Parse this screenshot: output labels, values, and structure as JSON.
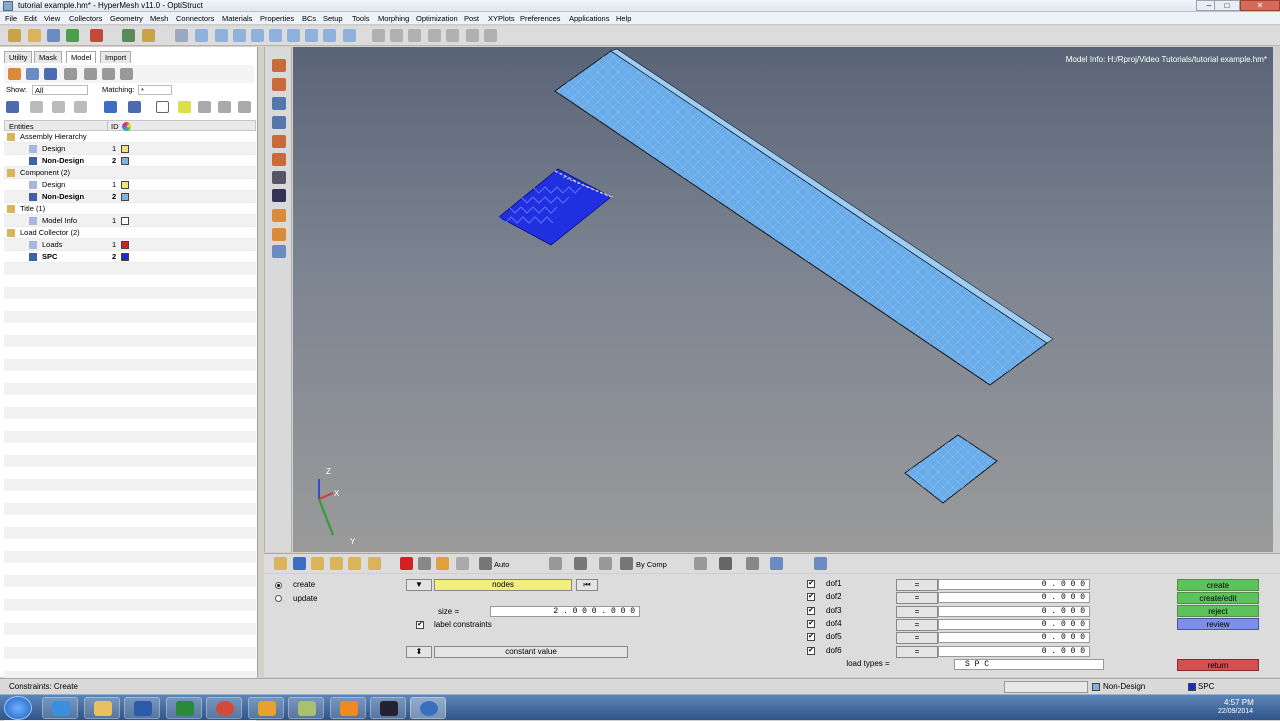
{
  "window": {
    "title": "tutorial example.hm* - HyperMesh v11.0 - OptiStruct",
    "minimize": "–",
    "maximize": "□",
    "close": "✕"
  },
  "menu": [
    "File",
    "Edit",
    "View",
    "Collectors",
    "Geometry",
    "Mesh",
    "Connectors",
    "Materials",
    "Properties",
    "BCs",
    "Setup",
    "Tools",
    "Morphing",
    "Optimization",
    "Post",
    "XYPlots",
    "Preferences",
    "Applications",
    "Help"
  ],
  "left_panel": {
    "tabs": [
      "Utility",
      "Mask",
      "Model",
      "Import"
    ],
    "active_tab": "Model",
    "show_label": "Show:",
    "show_value": "All",
    "matching_label": "Matching:",
    "matching_value": "*",
    "headers": {
      "entities": "Entities",
      "id": "ID"
    },
    "tree": [
      {
        "label": "Assembly Hierarchy",
        "indent": 0,
        "bold": false,
        "id": "",
        "swatch": ""
      },
      {
        "label": "Design",
        "indent": 2,
        "bold": false,
        "id": "1",
        "swatch": "#f2e27a"
      },
      {
        "label": "Non-Design",
        "indent": 2,
        "bold": true,
        "id": "2",
        "swatch": "#7fb2e0"
      },
      {
        "label": "Component (2)",
        "indent": 0,
        "bold": false,
        "id": "",
        "swatch": ""
      },
      {
        "label": "Design",
        "indent": 2,
        "bold": false,
        "id": "1",
        "swatch": "#f2e27a"
      },
      {
        "label": "Non-Design",
        "indent": 2,
        "bold": true,
        "id": "2",
        "swatch": "#7fb2e0"
      },
      {
        "label": "Title (1)",
        "indent": 0,
        "bold": false,
        "id": "",
        "swatch": ""
      },
      {
        "label": "Model Info",
        "indent": 2,
        "bold": false,
        "id": "1",
        "swatch": "#ffffff"
      },
      {
        "label": "Load Collector (2)",
        "indent": 0,
        "bold": false,
        "id": "",
        "swatch": ""
      },
      {
        "label": "Loads",
        "indent": 2,
        "bold": false,
        "id": "1",
        "swatch": "#d42020"
      },
      {
        "label": "SPC",
        "indent": 2,
        "bold": true,
        "id": "2",
        "swatch": "#1d2cc8"
      }
    ]
  },
  "viewport": {
    "model_info": "Model Info: H:/Rproj/Video Tutorials/tutorial example.hm*",
    "axes": {
      "x": "X",
      "y": "Y",
      "z": "Z"
    },
    "colors": {
      "part": "#6aacea",
      "spc": "#2030e0"
    }
  },
  "bottom_toolbar": {
    "vis_mode": "Auto",
    "color_mode": "By Comp"
  },
  "panel": {
    "radio_create": "create",
    "radio_update": "update",
    "selected_radio": "create",
    "entity_selector": "nodes",
    "size_label": "size =",
    "size_value": "2 . 0 0 0 . 0 0 0",
    "label_constraints": "label constraints",
    "label_constraints_checked": true,
    "constant_value": "constant value",
    "dofs": [
      {
        "name": "dof1",
        "checked": true,
        "eq": "=",
        "value": "0 . 0 0 0"
      },
      {
        "name": "dof2",
        "checked": true,
        "eq": "=",
        "value": "0 . 0 0 0"
      },
      {
        "name": "dof3",
        "checked": true,
        "eq": "=",
        "value": "0 . 0 0 0"
      },
      {
        "name": "dof4",
        "checked": true,
        "eq": "=",
        "value": "0 . 0 0 0"
      },
      {
        "name": "dof5",
        "checked": true,
        "eq": "=",
        "value": "0 . 0 0 0"
      },
      {
        "name": "dof6",
        "checked": true,
        "eq": "=",
        "value": "0 . 0 0 0"
      }
    ],
    "load_types_label": "load types =",
    "load_types_value": "S P C",
    "buttons": {
      "create": "create",
      "create_edit": "create/edit",
      "reject": "reject",
      "review": "review",
      "return": "return"
    },
    "colors": {
      "green": "#5cc35c",
      "blue": "#7f8fe8",
      "red": "#d25050",
      "highlight": "#f2f07a"
    }
  },
  "statusbar": {
    "message": "Constraints: Create",
    "component": "Non-Design",
    "load_collector": "SPC"
  },
  "taskbar": {
    "time": "4:57 PM",
    "date": "22/09/2014"
  }
}
